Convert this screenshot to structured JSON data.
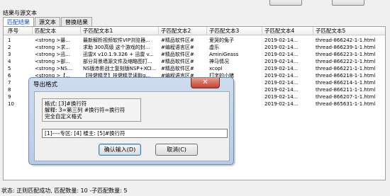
{
  "results_group": {
    "title": "结果与源文本"
  },
  "tabs": [
    {
      "label": "匹配结果"
    },
    {
      "label": "源文本"
    },
    {
      "label": "替换结果"
    }
  ],
  "grid": {
    "headers": [
      "序号",
      "匹配文本",
      "子匹配文本1",
      "子匹配文本2",
      "子匹配文本3",
      "子匹配文本4",
      "子匹配文本5"
    ],
    "rows": [
      [
        "1",
        "<strong >最...",
        "最新解析视频软件VIP浏览器...",
        "#精品软件区#",
        "爱哭的兔子",
        "2019-02-14...",
        "thread-866242-1-1.html"
      ],
      [
        "2",
        "<strong >求...",
        "求助 300高级 这个游戏的封...",
        "#编程语言区#",
        "虚乐",
        "2019-02-14...",
        "thread-866239-1-1.html"
      ],
      [
        "3",
        "<strong >迅...",
        "迅雷X v10.1.9.326 + 迅雷 v...",
        "#精品软件区#",
        "AminiGeass",
        "2019-02-14...",
        "thread-866223-1-1.html"
      ],
      [
        "4",
        "<strong >部...",
        "部分背景墙源文件及缩略图打...",
        "#精品软件区#",
        "神马情况",
        "2019-02-14...",
        "thread-866222-1-1.html"
      ],
      [
        "5",
        "<strong >NS...",
        "NS版赤影战士复刻版NSP+XCI...",
        "#精品软件区#",
        "xcopl",
        "2019-02-14...",
        "thread-866221-1-1.html"
      ],
      [
        "6",
        "<strong >【...",
        "【技健精灵】技健精灵读取g...",
        "#编程语言区#",
        "打字的小猪",
        "2019-02-14...",
        "thread-866218-1-1.html"
      ],
      [
        "7",
        "",
        "",
        "",
        "",
        "2019-02-14...",
        "thread-866214-1-1.html"
      ],
      [
        "8",
        "",
        "",
        "",
        "",
        "2019-02-14...",
        "thread-866211-1-1.html"
      ],
      [
        "9",
        "",
        "",
        "",
        "",
        "2019-02-14...",
        "thread-866207-1-1.html"
      ],
      [
        "10",
        "",
        "",
        "",
        "",
        "2019-02-14...",
        "thread-865631-1-1.html"
      ]
    ]
  },
  "dialog": {
    "title": "导出格式",
    "close_glyph": "✕",
    "format_lines": [
      "格式: [3]#换行符",
      "解释: 3=第三列 #换行符=换行符",
      "完全自定义格式"
    ],
    "input_value": "[1]----专区: [4]  楼主: [5]#换行符",
    "ok_label": "确认输入(D)",
    "cancel_label": "取消(C)"
  },
  "status": {
    "text": "状态: 正则匹配成功, 匹配数量: 10 -子匹配数量: 5"
  }
}
